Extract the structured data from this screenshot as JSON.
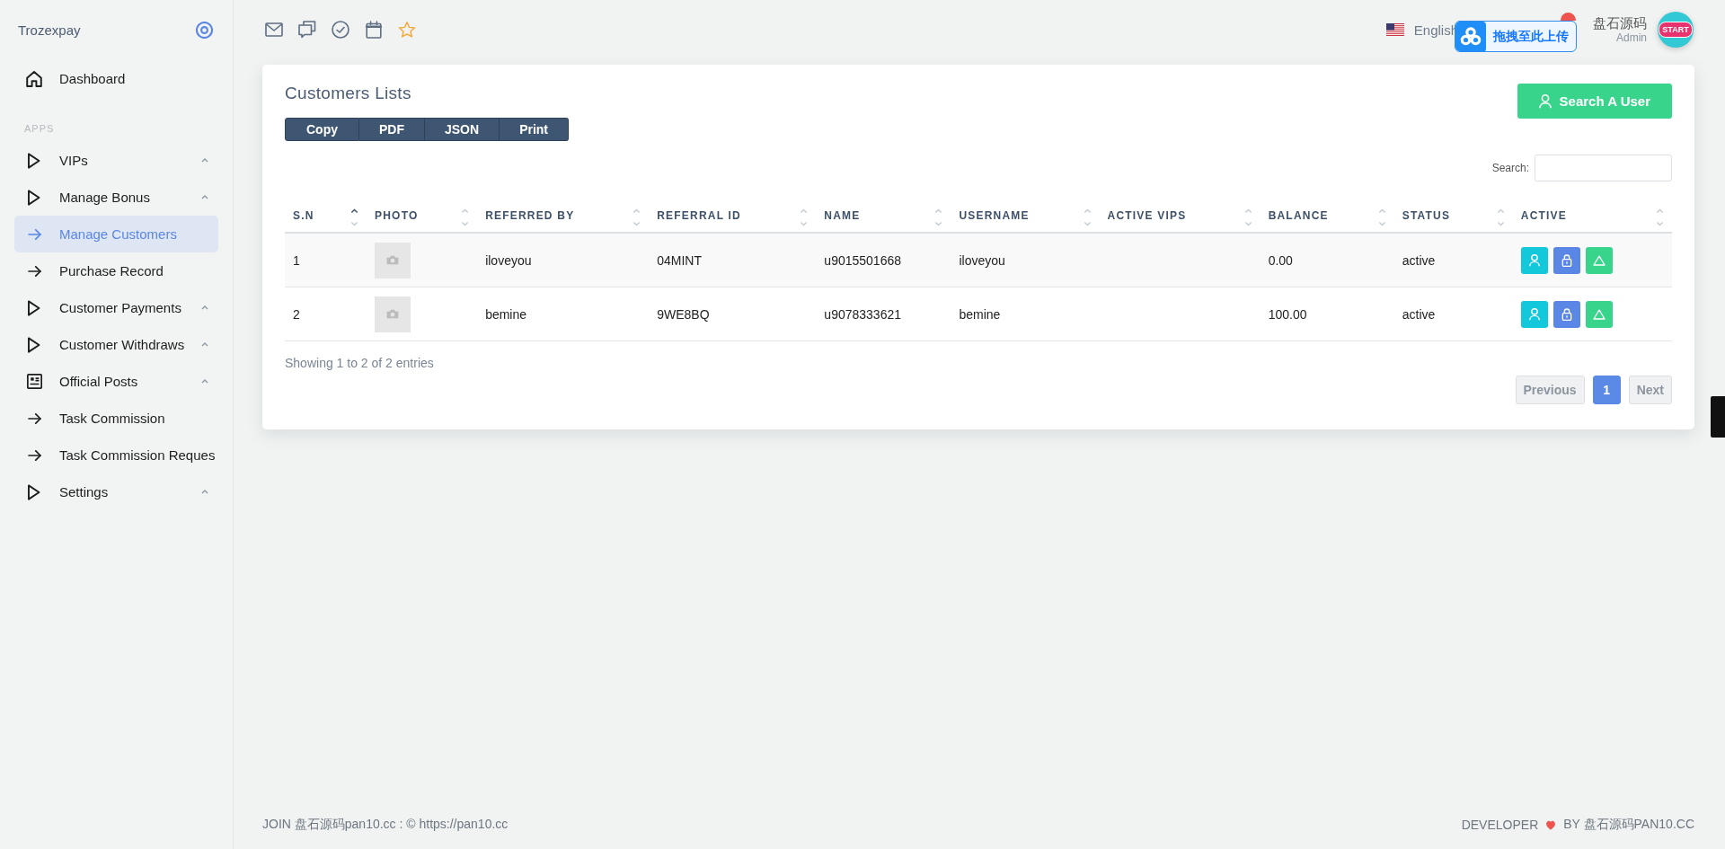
{
  "sidebar": {
    "brand": "Trozexpay",
    "top_items": [
      {
        "label": "Dashboard",
        "kind": "home",
        "selected": false
      }
    ],
    "sections": [
      {
        "label": "APPS",
        "items": [
          {
            "label": "VIPs",
            "kind": "group",
            "selected": false
          },
          {
            "label": "Manage Bonus",
            "kind": "group",
            "selected": false
          },
          {
            "label": "Manage Customers",
            "kind": "link",
            "selected": true
          },
          {
            "label": "Purchase Record",
            "kind": "link",
            "selected": false
          },
          {
            "label": "Customer Payments",
            "kind": "group",
            "selected": false
          },
          {
            "label": "Customer Withdraws",
            "kind": "group",
            "selected": false
          },
          {
            "label": "Official Posts",
            "kind": "posts",
            "selected": false
          },
          {
            "label": "Task Commission",
            "kind": "link",
            "selected": false
          },
          {
            "label": "Task Commission Reques",
            "kind": "link",
            "selected": false
          },
          {
            "label": "Settings",
            "kind": "group",
            "selected": false
          }
        ]
      }
    ]
  },
  "topbar": {
    "language": "English",
    "upload_widget": "拖拽至此上传",
    "user": {
      "name": "盘石源码",
      "role": "Admin",
      "avatar_text": "START"
    }
  },
  "card": {
    "title": "Customers Lists",
    "export_buttons": [
      "Copy",
      "PDF",
      "JSON",
      "Print"
    ],
    "search_user_button": "Search A User",
    "search_label": "Search:",
    "table": {
      "columns": [
        {
          "label": "S.N",
          "sorted": true
        },
        {
          "label": "PHOTO",
          "sorted": false
        },
        {
          "label": "REFERRED BY",
          "sorted": false
        },
        {
          "label": "REFERRAL ID",
          "sorted": false
        },
        {
          "label": "NAME",
          "sorted": false
        },
        {
          "label": "USERNAME",
          "sorted": false
        },
        {
          "label": "ACTIVE VIPS",
          "sorted": false
        },
        {
          "label": "BALANCE",
          "sorted": false
        },
        {
          "label": "STATUS",
          "sorted": false
        },
        {
          "label": "ACTIVE",
          "sorted": false
        }
      ],
      "rows": [
        {
          "sn": "1",
          "referred_by": "iloveyou",
          "referral_id": "04MINT",
          "name": "u9015501668",
          "username": "iloveyou",
          "balance": "0.00",
          "status": "active"
        },
        {
          "sn": "2",
          "referred_by": "bemine",
          "referral_id": "9WE8BQ",
          "name": "u9078333621",
          "username": "bemine",
          "balance": "100.00",
          "status": "active"
        }
      ]
    },
    "info": "Showing 1 to 2 of 2 entries",
    "pagination": [
      {
        "label": "Previous",
        "kind": "prev",
        "selected": false,
        "disabled": true
      },
      {
        "label": "1",
        "kind": "page",
        "selected": true,
        "disabled": false
      },
      {
        "label": "Next",
        "kind": "next",
        "selected": false,
        "disabled": true
      }
    ]
  },
  "footer": {
    "copyright": "JOIN 盘石源码pan10.cc : © https://pan10.cc",
    "credit_prefix": "DEVELOPER",
    "credit_suffix": "BY 盘石源码PAN10.CC"
  }
}
